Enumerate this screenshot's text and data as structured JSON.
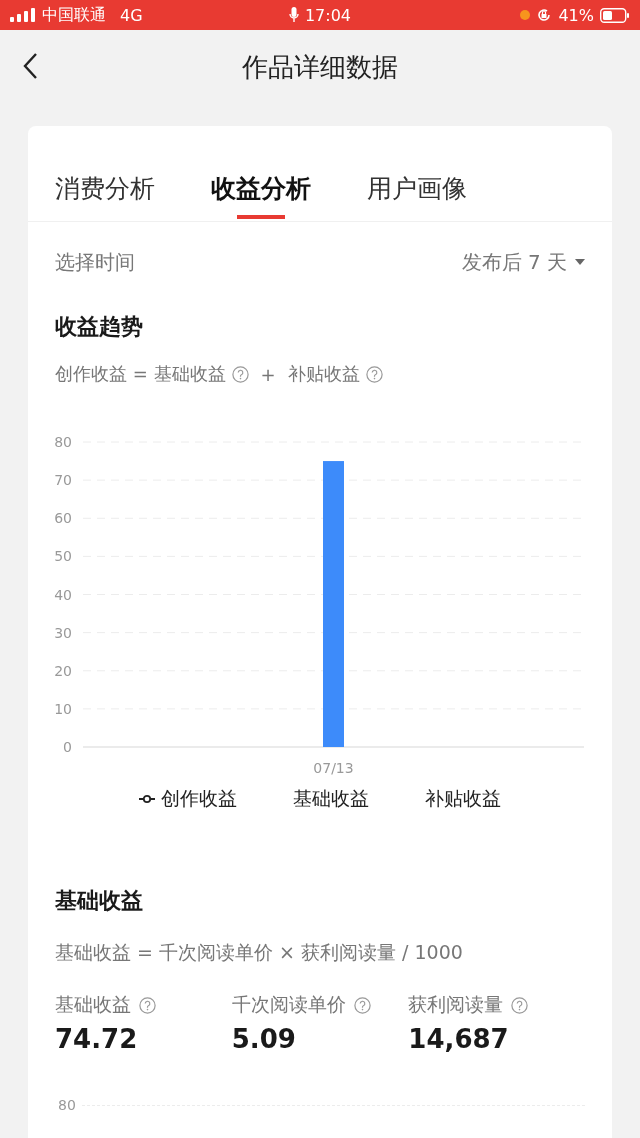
{
  "status_bar": {
    "carrier": "中国联通",
    "network": "4G",
    "time": "17:04",
    "battery": "41%"
  },
  "nav": {
    "title": "作品详细数据"
  },
  "tabs": [
    {
      "label": "消费分析",
      "selected": false
    },
    {
      "label": "收益分析",
      "selected": true
    },
    {
      "label": "用户画像",
      "selected": false
    }
  ],
  "time_filter": {
    "label": "选择时间",
    "value": "发布后 7 天"
  },
  "trend": {
    "title": "收益趋势",
    "formula": [
      {
        "kind": "text",
        "text": "创作收益 = 基础收益"
      },
      {
        "kind": "help"
      },
      {
        "kind": "text",
        "text": "+"
      },
      {
        "kind": "text",
        "text": "补贴收益"
      },
      {
        "kind": "help"
      }
    ],
    "chart_data": {
      "type": "bar",
      "categories": [
        "07/13"
      ],
      "values": [
        75
      ],
      "ylim": [
        0,
        80
      ],
      "yticks": [
        0,
        10,
        20,
        30,
        40,
        50,
        60,
        70,
        80
      ],
      "grid": true
    },
    "legend": [
      {
        "label": "创作收益",
        "kind": "line"
      },
      {
        "label": "基础收益",
        "kind": "plain"
      },
      {
        "label": "补贴收益",
        "kind": "plain"
      }
    ]
  },
  "basic": {
    "title": "基础收益",
    "formula": "基础收益 = 千次阅读单价 × 获利阅读量 / 1000",
    "metrics": [
      {
        "label": "基础收益",
        "value": "74.72"
      },
      {
        "label": "千次阅读单价",
        "value": "5.09"
      },
      {
        "label": "获利阅读量",
        "value": "14,687"
      }
    ],
    "next_chart_tick": "80"
  }
}
